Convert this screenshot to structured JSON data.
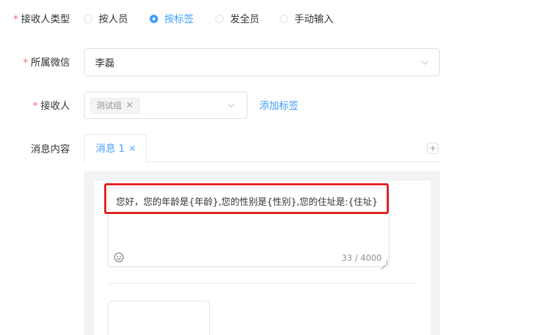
{
  "receiver_type": {
    "label": "接收人类型",
    "required_mark": "*",
    "options": [
      {
        "label": "按人员",
        "selected": false
      },
      {
        "label": "按标签",
        "selected": true
      },
      {
        "label": "发全员",
        "selected": false
      },
      {
        "label": "手动输入",
        "selected": false
      }
    ]
  },
  "wechat": {
    "label": "所属微信",
    "required_mark": "*",
    "value": "李磊"
  },
  "receiver": {
    "label": "接收人",
    "required_mark": "*",
    "tags": [
      {
        "label": "测试组",
        "close": "×"
      }
    ],
    "add_tag_link": "添加标签"
  },
  "message": {
    "label": "消息内容",
    "tabs": [
      {
        "label": "消息 1",
        "close": "×"
      }
    ],
    "add_tab": "+",
    "text": "您好，您的年龄是{年龄},您的性别是{性别},您的住址是:{住址}",
    "counter": "33 / 4000",
    "emoji_icon": "smile-icon"
  },
  "colors": {
    "primary": "#409eff",
    "required": "#f56c6c",
    "highlight": "#e02020",
    "panel_bg": "#f2f3f5"
  }
}
